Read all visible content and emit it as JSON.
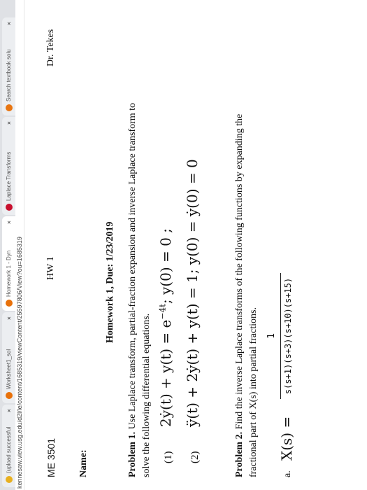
{
  "browser": {
    "tabs": [
      {
        "title": "(upload successful",
        "icon": "upload-icon",
        "color": "#e8b020"
      },
      {
        "title": "Worksheet1_sol",
        "icon": "d2l-icon",
        "color": "#e8710a"
      },
      {
        "title": "Homework 1 - Dyn",
        "icon": "d2l-icon",
        "color": "#e8710a"
      },
      {
        "title": "Laplace Transforms",
        "icon": "symbolab-icon",
        "color": "#c8102e"
      },
      {
        "title": "Search textbook solu",
        "icon": "chegg-icon",
        "color": "#e87511"
      }
    ],
    "url": "kennesaw.view.usg.edu/d2l/le/content/1685319/viewContent/25597806/View?ou=1685319"
  },
  "doc": {
    "course": "ME 3501",
    "hw": "HW 1",
    "instructor": "Dr. Tekes",
    "name_label": "Name:",
    "heading": "Homework 1, Due: 1/23/2019",
    "p1_title": "Problem 1.",
    "p1_line1": "Use Laplace transform, partial-fraction expansion and inverse Laplace transform to",
    "p1_line2": "solve the following differential equations.",
    "eq1": {
      "num": "(1)",
      "lhs": "2ẏ(t) + y(t) = e",
      "exp": "−4t",
      "cond": ";   y(0) = 0 ;"
    },
    "eq2": {
      "num": "(2)",
      "body": "ÿ(t) + 2ẏ(t) + y(t) = 1;   y(0) = ẏ(0) = 0"
    },
    "p2_title": "Problem 2.",
    "p2_line1": "Find the inverse Laplace transforms of the following functions by expanding the",
    "p2_line2": "fractional part of X(s) into partial fractions.",
    "item_a": {
      "label": "a.",
      "lhs": "X(s) =",
      "num": "1",
      "den": "s(s+1)(s+3)(s+10)(s+15)"
    }
  }
}
